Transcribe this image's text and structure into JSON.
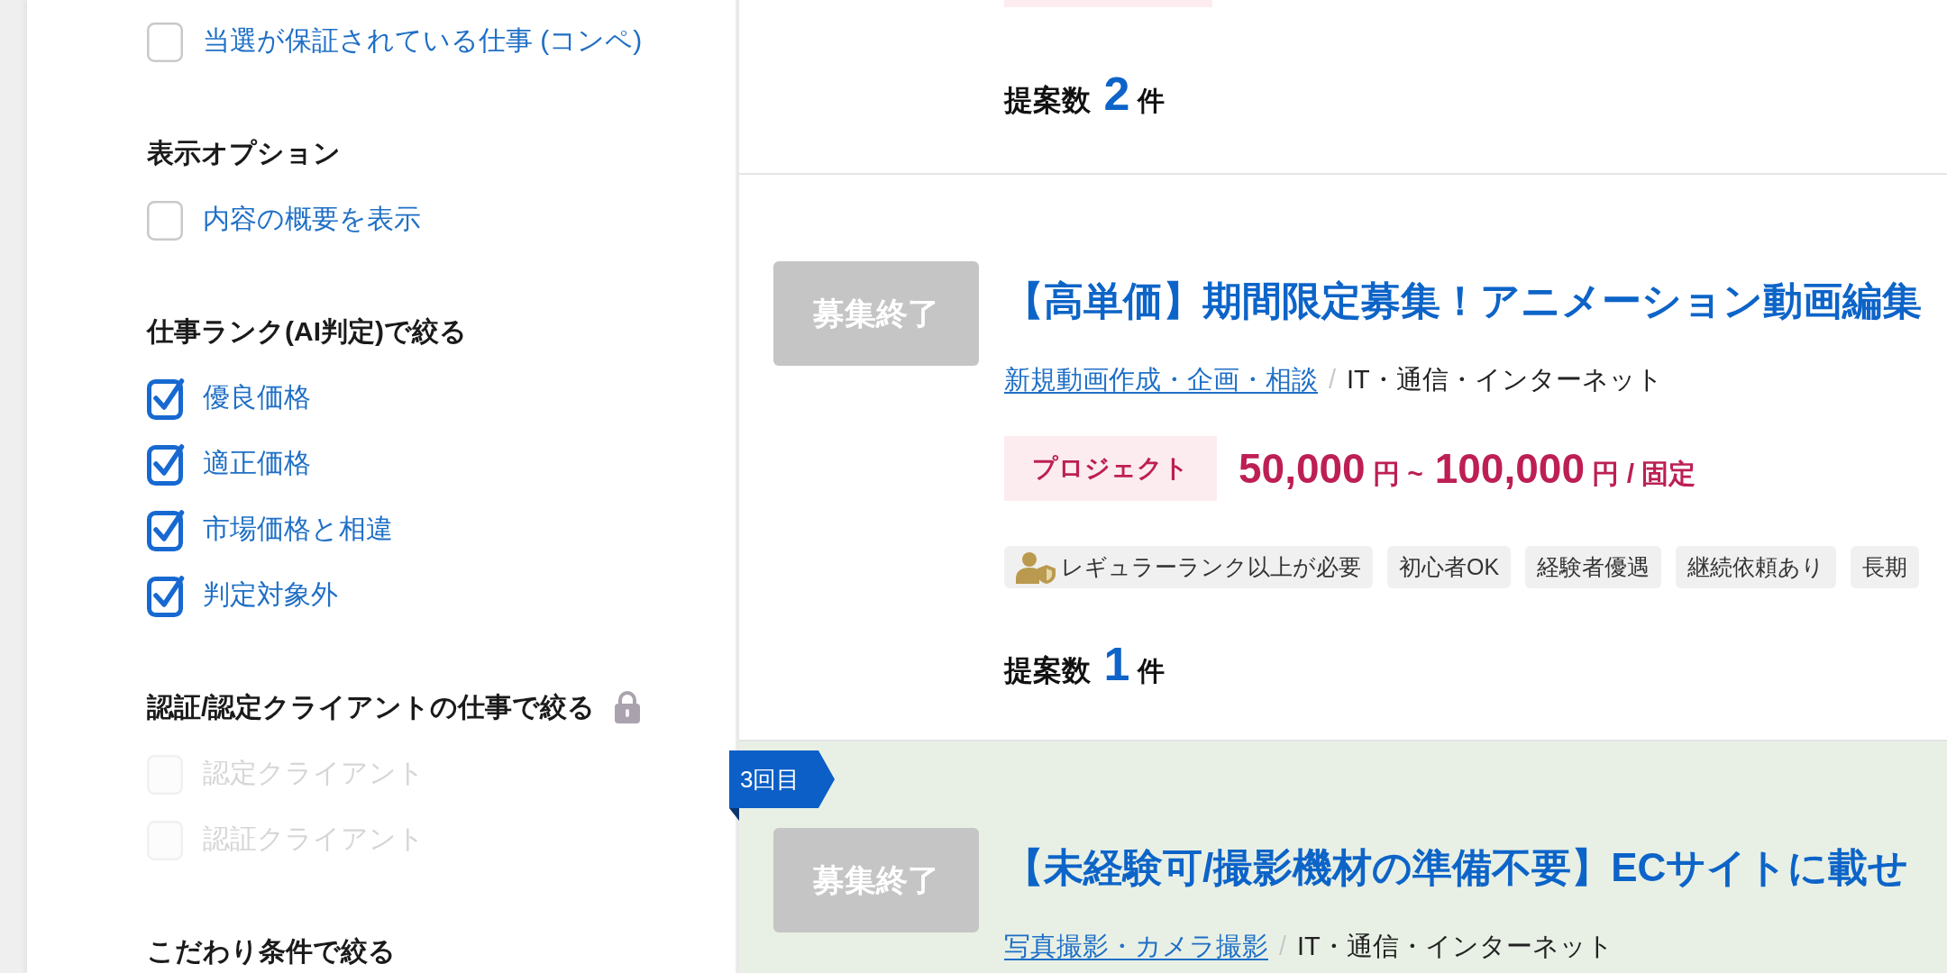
{
  "sidebar": {
    "items": [
      {
        "kind": "checkbox",
        "label": "当選が保証されている仕事 (コンペ)",
        "checked": false,
        "disabled": false
      },
      {
        "kind": "heading",
        "label": "表示オプション",
        "locked": false
      },
      {
        "kind": "checkbox",
        "label": "内容の概要を表示",
        "checked": false,
        "disabled": false
      },
      {
        "kind": "heading",
        "label": "仕事ランク(AI判定)で絞る",
        "locked": false
      },
      {
        "kind": "checkbox",
        "label": "優良価格",
        "checked": true,
        "disabled": false
      },
      {
        "kind": "checkbox",
        "label": "適正価格",
        "checked": true,
        "disabled": false
      },
      {
        "kind": "checkbox",
        "label": "市場価格と相違",
        "checked": true,
        "disabled": false
      },
      {
        "kind": "checkbox",
        "label": "判定対象外",
        "checked": true,
        "disabled": false
      },
      {
        "kind": "heading",
        "label": "認証/認定クライアントの仕事で絞る",
        "locked": true
      },
      {
        "kind": "checkbox",
        "label": "認定クライアント",
        "checked": false,
        "disabled": true
      },
      {
        "kind": "checkbox",
        "label": "認証クライアント",
        "checked": false,
        "disabled": true
      },
      {
        "kind": "heading",
        "label": "こだわり条件で絞る",
        "locked": false
      }
    ]
  },
  "jobs": [
    {
      "scrolled_off": true,
      "highlighted": false,
      "proposals": {
        "label": "提案数",
        "count": "2",
        "unit": "件"
      }
    },
    {
      "scrolled_off": false,
      "highlighted": false,
      "status": "募集終了",
      "title": "【高単価】期間限定募集！アニメーション動画編集",
      "category": "新規動画作成・企画・相談",
      "separator": "/",
      "industry": "IT・通信・インターネット",
      "type": "プロジェクト",
      "price": [
        {
          "kind": "amount",
          "text": "50,000"
        },
        {
          "kind": "unit",
          "text": "円 ~"
        },
        {
          "kind": "amount",
          "text": "100,000"
        },
        {
          "kind": "unit",
          "text": "円 / 固定"
        }
      ],
      "tags": [
        {
          "kind": "rank",
          "label": "レギュラーランク以上が必要"
        },
        {
          "kind": "plain",
          "label": "初心者OK"
        },
        {
          "kind": "plain",
          "label": "経験者優遇"
        },
        {
          "kind": "plain",
          "label": "継続依頼あり"
        },
        {
          "kind": "plain",
          "label": "長期"
        }
      ],
      "proposals": {
        "label": "提案数",
        "count": "1",
        "unit": "件"
      }
    },
    {
      "scrolled_off": false,
      "highlighted": true,
      "round": "3回目",
      "status": "募集終了",
      "title": "【未経験可/撮影機材の準備不要】ECサイトに載せ",
      "category": "写真撮影・カメラ撮影",
      "separator": "/",
      "industry": "IT・通信・インターネット"
    }
  ]
}
